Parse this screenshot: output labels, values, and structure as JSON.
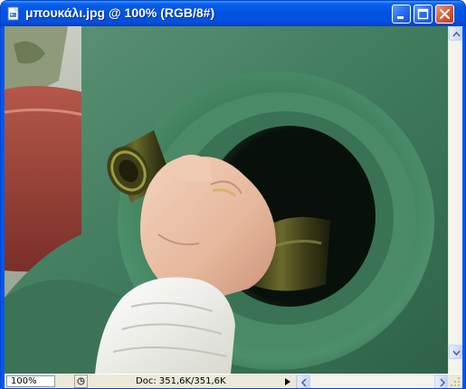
{
  "window": {
    "title": "μπουκάλι.jpg @ 100% (RGB/8#)",
    "icon": "photoshop-document-icon",
    "controls": {
      "minimize_icon": "minimize-icon",
      "maximize_icon": "maximize-icon",
      "close_icon": "close-icon"
    }
  },
  "canvas": {
    "image_subject": "hand-inserting-bottle-into-recycling-bin"
  },
  "statusbar": {
    "zoom": "100%",
    "doc_info": "Doc: 351,6K/351,6K"
  },
  "colors": {
    "titlebar_blue": "#0054e3",
    "close_red": "#e05a36",
    "bin_green": "#3f7a5a"
  }
}
